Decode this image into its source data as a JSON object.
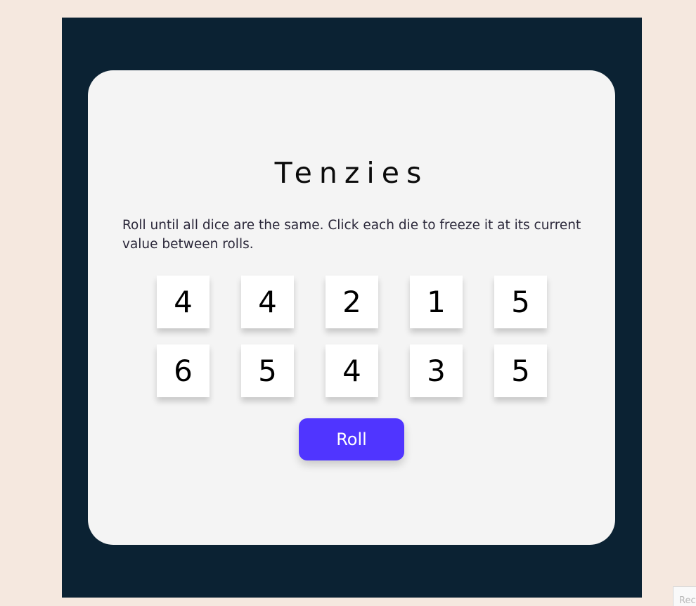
{
  "game": {
    "title": "Tenzies",
    "instructions": "Roll until all dice are the same. Click each die to freeze it at its current value between rolls.",
    "dice": [
      {
        "value": "4"
      },
      {
        "value": "4"
      },
      {
        "value": "2"
      },
      {
        "value": "1"
      },
      {
        "value": "5"
      },
      {
        "value": "6"
      },
      {
        "value": "5"
      },
      {
        "value": "4"
      },
      {
        "value": "3"
      },
      {
        "value": "5"
      }
    ],
    "roll_label": "Roll"
  },
  "corner_badge": {
    "label": "Rec"
  },
  "colors": {
    "page_background": "#f5e8df",
    "frame_background": "#0b2233",
    "card_background": "#f4f4f4",
    "die_background": "#ffffff",
    "button_background": "#5035ff"
  }
}
